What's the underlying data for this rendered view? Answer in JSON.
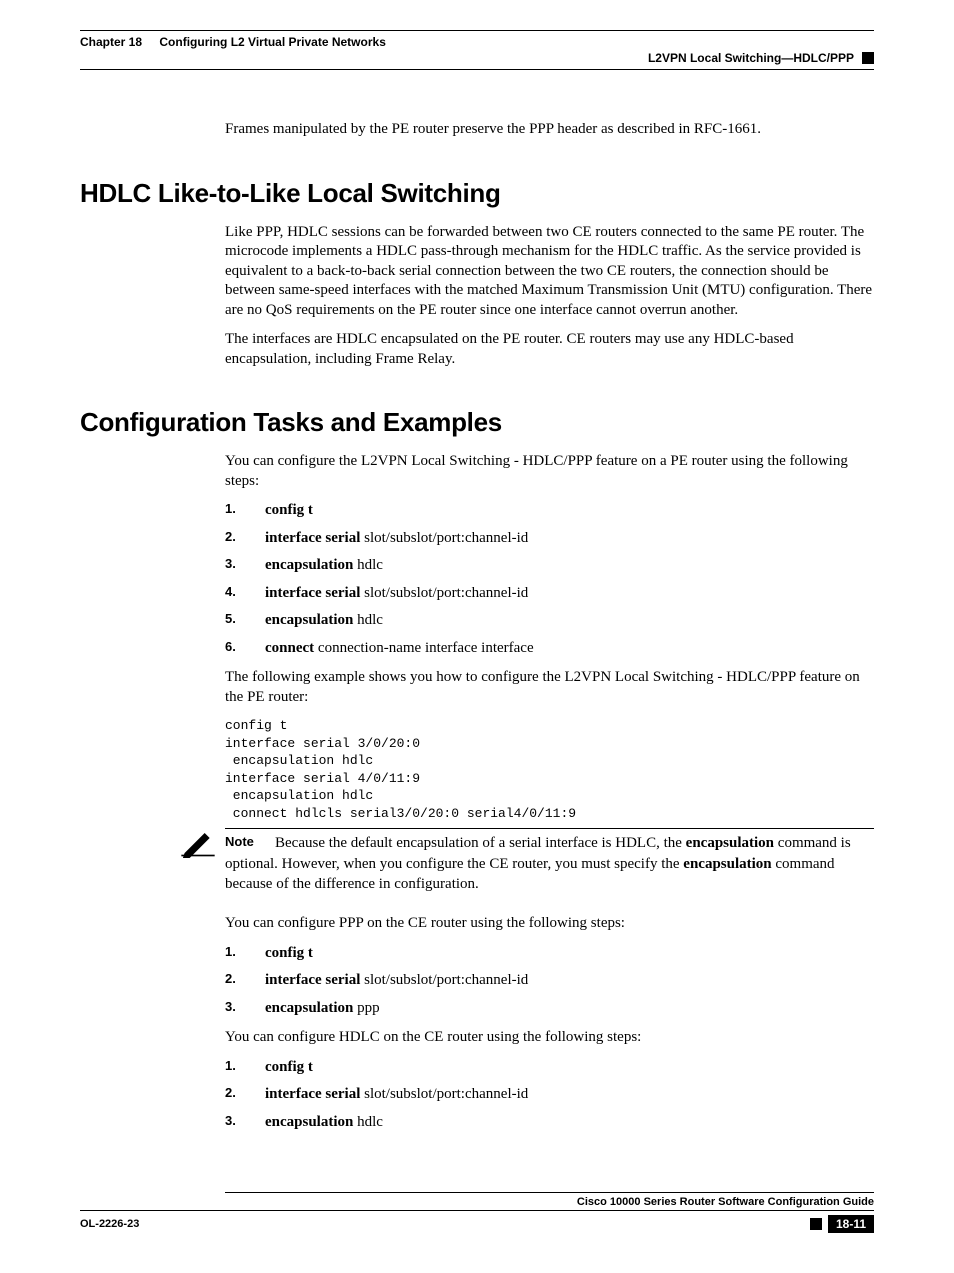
{
  "header": {
    "chapter_num": "Chapter 18",
    "chapter_title": "Configuring L2 Virtual Private Networks",
    "section_right": "L2VPN Local Switching—HDLC/PPP"
  },
  "intro_para": "Frames manipulated by the PE router preserve the PPP header as described in RFC-1661.",
  "h2_1": "HDLC Like-to-Like Local Switching",
  "hdlc_para1": "Like PPP, HDLC sessions can be forwarded between two CE routers connected to the same PE router. The microcode implements a HDLC pass-through mechanism for the HDLC traffic. As the service provided is equivalent to a back-to-back serial connection between the two CE routers, the connection should be between same-speed interfaces with the matched Maximum Transmission Unit (MTU) configuration. There are no QoS requirements on the PE router since one interface cannot overrun another.",
  "hdlc_para2": "The interfaces are HDLC encapsulated on the PE router. CE routers may use any HDLC-based encapsulation, including Frame Relay.",
  "h2_2": "Configuration Tasks and Examples",
  "cfg_intro": "You can configure the L2VPN Local Switching - HDLC/PPP feature on a PE router using the following steps:",
  "steps_pe": [
    {
      "num": "1.",
      "cmd": "config t",
      "arg": ""
    },
    {
      "num": "2.",
      "cmd": "interface serial",
      "arg": " slot/subslot/port:channel-id"
    },
    {
      "num": "3.",
      "cmd": "encapsulation",
      "arg": " hdlc"
    },
    {
      "num": "4.",
      "cmd": "interface serial",
      "arg": " slot/subslot/port:channel-id"
    },
    {
      "num": "5.",
      "cmd": "encapsulation",
      "arg": " hdlc"
    },
    {
      "num": "6.",
      "cmd": "connect",
      "arg": " connection-name interface interface"
    }
  ],
  "example_intro": "The following example shows you how to configure the L2VPN Local Switching - HDLC/PPP feature on the PE router:",
  "code_block": "config t\ninterface serial 3/0/20:0\n encapsulation hdlc\ninterface serial 4/0/11:9\n encapsulation hdlc\n connect hdlcls serial3/0/20:0 serial4/0/11:9",
  "note_label": "Note",
  "note_text_pre": "Because the default encapsulation of a serial interface is HDLC, the ",
  "note_bold1": "encapsulation",
  "note_text_mid": " command is optional. However, when you configure the CE router, you must specify the ",
  "note_bold2": "encapsulation",
  "note_text_post": " command because of the difference in configuration.",
  "ppp_intro": "You can configure PPP on the CE router using the following steps:",
  "steps_ppp": [
    {
      "num": "1.",
      "cmd": "config t",
      "arg": ""
    },
    {
      "num": "2.",
      "cmd": "interface serial",
      "arg": " slot/subslot/port:channel-id"
    },
    {
      "num": "3.",
      "cmd": "encapsulation",
      "arg": " ppp"
    }
  ],
  "hdlc_ce_intro": "You can configure HDLC on the CE router using the following steps:",
  "steps_hdlc_ce": [
    {
      "num": "1.",
      "cmd": "config t",
      "arg": ""
    },
    {
      "num": "2.",
      "cmd": "interface serial",
      "arg": " slot/subslot/port:channel-id"
    },
    {
      "num": "3.",
      "cmd": "encapsulation",
      "arg": " hdlc"
    }
  ],
  "footer": {
    "guide_title": "Cisco 10000 Series Router Software Configuration Guide",
    "doc_id": "OL-2226-23",
    "page_num": "18-11"
  }
}
